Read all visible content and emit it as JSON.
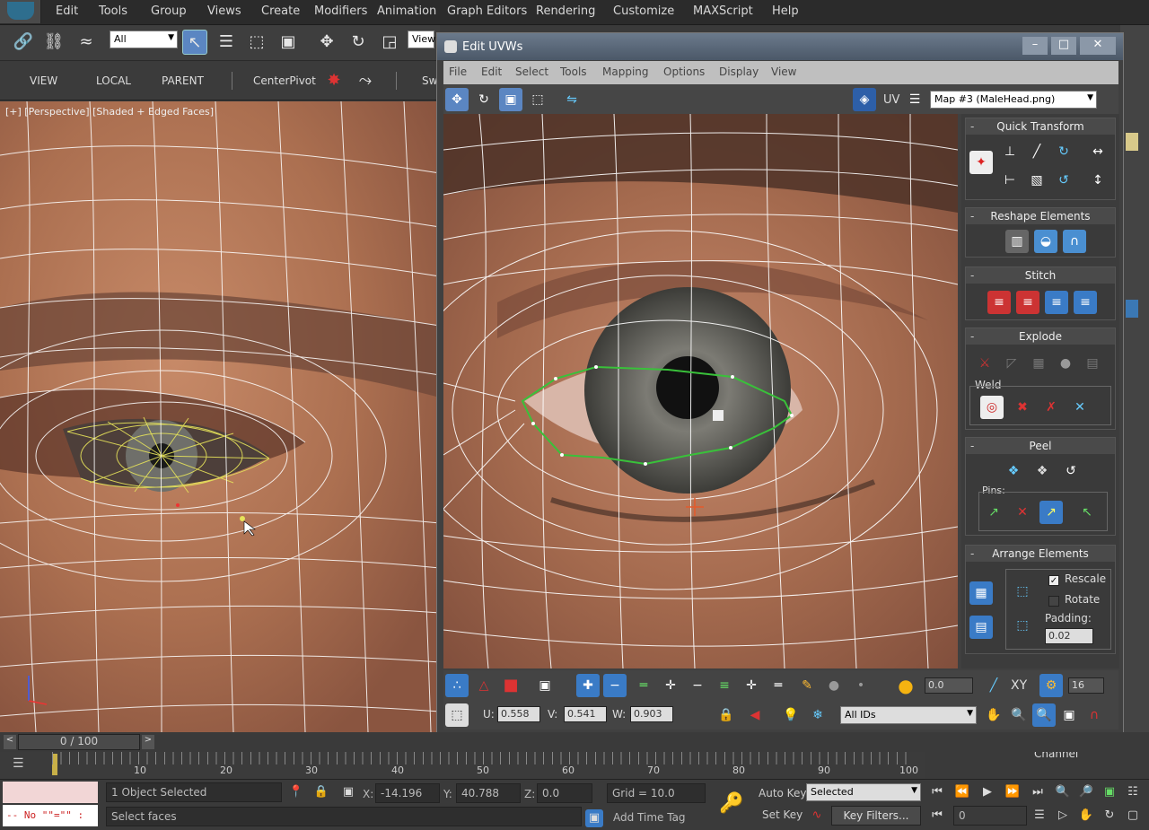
{
  "menubar": {
    "items": [
      "Edit",
      "Tools",
      "Group",
      "Views",
      "Create",
      "Modifiers",
      "Animation",
      "Graph Editors",
      "Rendering",
      "Customize",
      "MAXScript",
      "Help"
    ]
  },
  "toolbar": {
    "selection_filter": "All",
    "ref_coord": "View",
    "center_pivot": "CenterPivot"
  },
  "toolbar2": {
    "view": "VIEW",
    "local": "LOCAL",
    "parent": "PARENT",
    "sw": "Sw"
  },
  "viewport": {
    "label": "[+] [Perspective] [Shaded + Edged Faces]"
  },
  "uvw": {
    "title": "Edit UVWs",
    "menu": [
      "File",
      "Edit",
      "Select",
      "Tools",
      "Mapping",
      "Options",
      "Display",
      "View"
    ],
    "uv_label": "UV",
    "map_select": "Map #3 (MaleHead.png)",
    "rollouts": {
      "quick_transform": "Quick Transform",
      "reshape": "Reshape Elements",
      "stitch": "Stitch",
      "explode": "Explode",
      "weld": "Weld",
      "peel": "Peel",
      "pins": "Pins:",
      "arrange": "Arrange Elements",
      "rescale": "Rescale",
      "rotate": "Rotate",
      "padding_label": "Padding:",
      "padding_value": "0.02"
    },
    "bottom": {
      "soft_value": "0.0",
      "xy": "XY",
      "tile_value": "16",
      "u_label": "U:",
      "u_value": "0.558",
      "v_label": "V:",
      "v_value": "0.541",
      "w_label": "W:",
      "w_value": "0.903",
      "ids": "All IDs"
    },
    "channel": "Channel"
  },
  "timeline": {
    "frame": "0 / 100",
    "ticks": [
      "10",
      "20",
      "30",
      "40",
      "50",
      "60",
      "70",
      "80",
      "90",
      "100"
    ]
  },
  "status": {
    "script": "-- No \"\"=\"\" :",
    "selected": "1 Object Selected",
    "prompt": "Select faces",
    "x_label": "X:",
    "x_value": "-14.196",
    "y_label": "Y:",
    "y_value": "40.788",
    "z_label": "Z:",
    "z_value": "0.0",
    "grid": "Grid = 10.0",
    "add_time_tag": "Add Time Tag",
    "auto_key": "Auto Key",
    "set_key": "Set Key",
    "key_mode": "Selected",
    "key_filters": "Key Filters...",
    "frame_field": "0"
  },
  "colors": {
    "accent": "#5b86c2",
    "skin": "#b0785a",
    "wire": "#ffffff",
    "selection": "#39c13a"
  }
}
